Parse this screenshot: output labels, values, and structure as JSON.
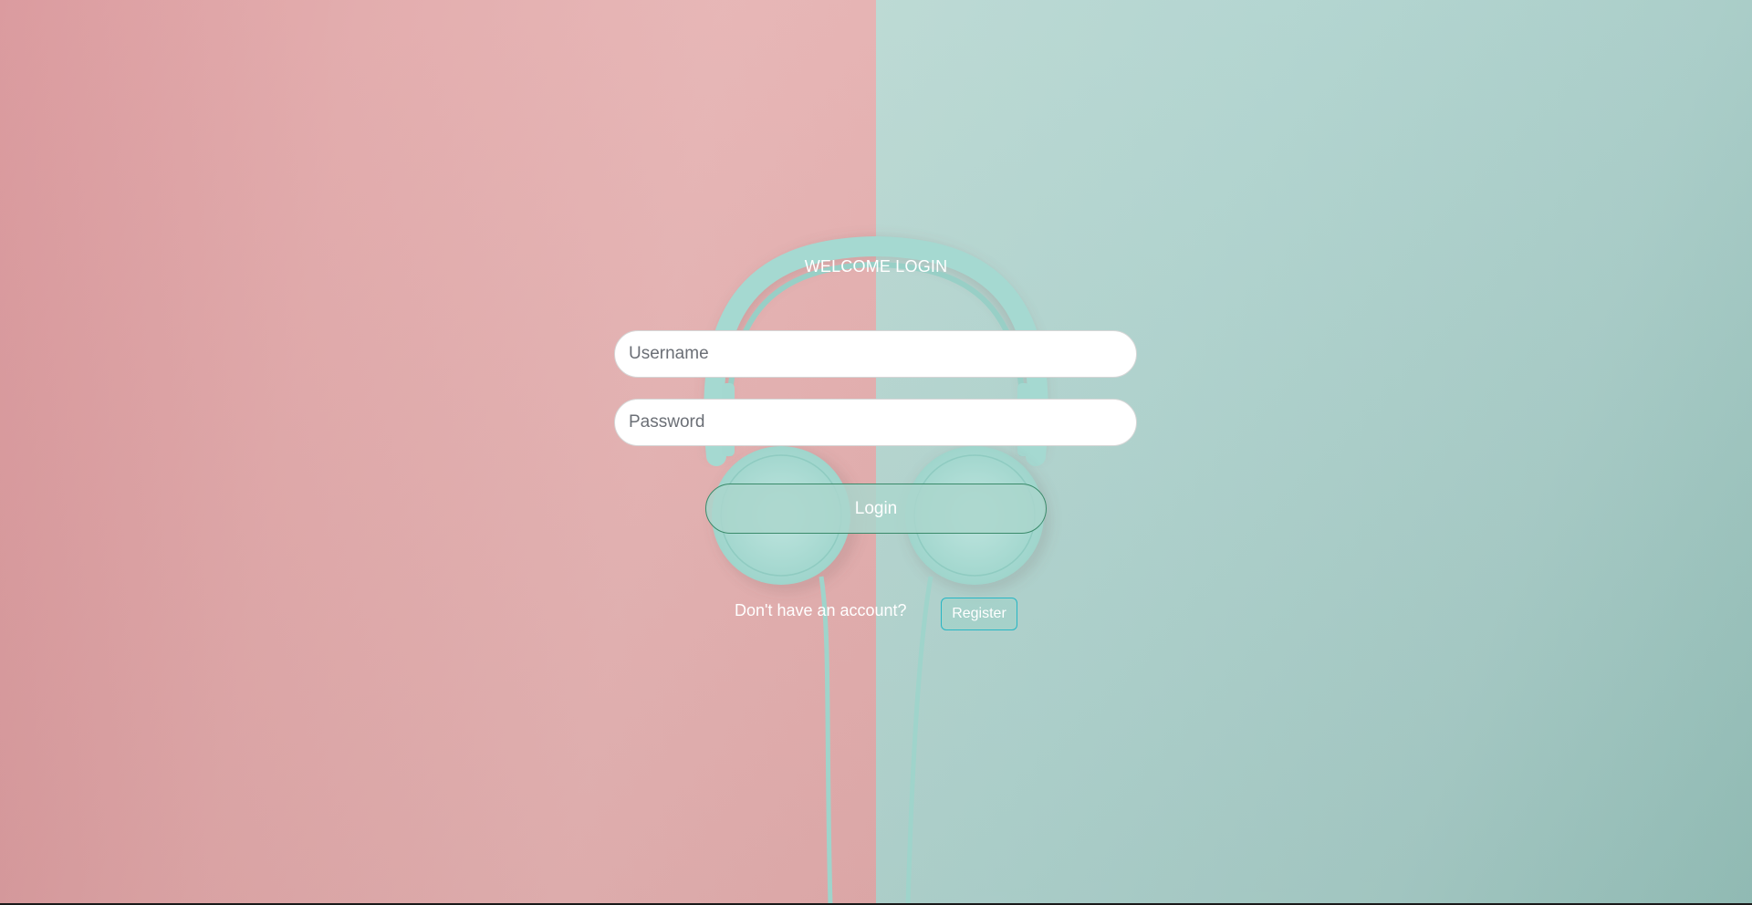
{
  "login": {
    "title": "WELCOME LOGIN",
    "username_placeholder": "Username",
    "password_placeholder": "Password",
    "login_label": "Login",
    "account_prompt": "Don't have an account?",
    "register_label": "Register"
  },
  "colors": {
    "left_background": "#e2a9aa",
    "right_background": "#afd3ce",
    "headphones": "#a9dcd5",
    "login_button_border": "#3a8a6a",
    "register_button_border": "#27b6c4"
  },
  "icons": {
    "background_decor": "headphones-image"
  }
}
